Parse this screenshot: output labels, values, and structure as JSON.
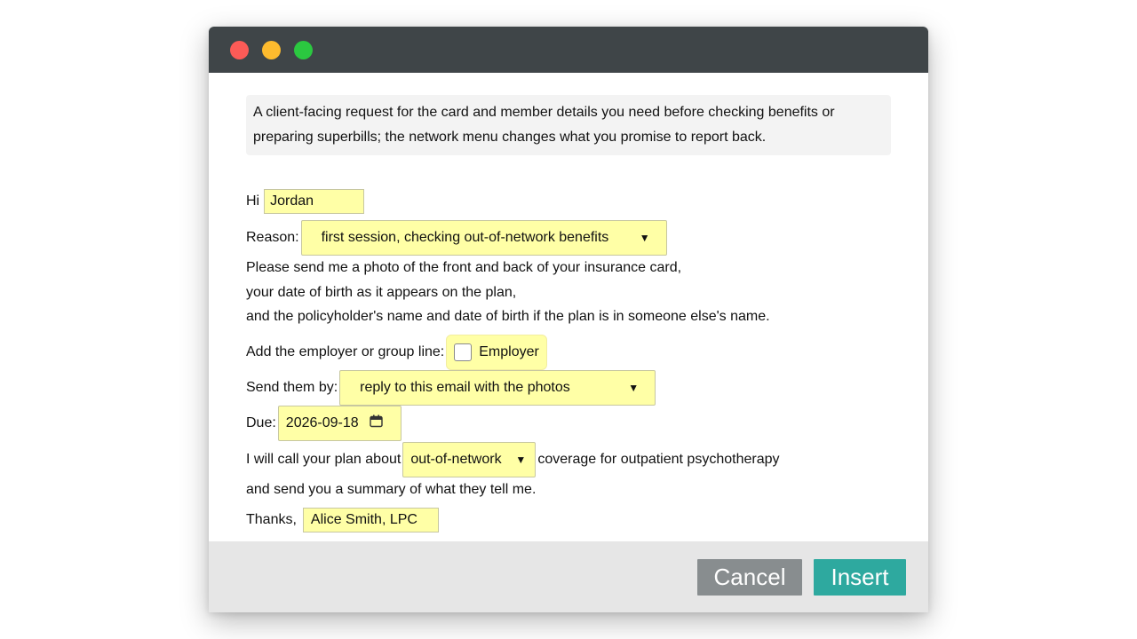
{
  "colors": {
    "titlebar": "#3f4548",
    "field_fill": "#ffffa6",
    "cancel_button": "#888d8f",
    "insert_button": "#2ea99f",
    "footer": "#e6e6e6"
  },
  "icons": [
    "close-light",
    "minimize-light",
    "zoom-light",
    "chevron-down-icon",
    "calendar-icon"
  ],
  "description": "A client-facing request for the card and member details you need before checking benefits or preparing superbills; the network menu changes what you promise to report back.",
  "greeting": {
    "label": "Hi",
    "name_value": "Jordan"
  },
  "reason": {
    "label": "Reason:",
    "selected": "first session, checking out-of-network benefits"
  },
  "body_lines": [
    "Please send me a photo of the front and back of your insurance card,",
    "your date of birth as it appears on the plan,",
    "and the policyholder's name and date of birth if the plan is in someone else's name."
  ],
  "employer": {
    "label": "Add the employer or group line:",
    "checkbox_label": "Employer",
    "checked": false
  },
  "send_by": {
    "label": "Send them by:",
    "selected": "reply to this email with the photos"
  },
  "due": {
    "label": "Due:",
    "value": "2026-09-18"
  },
  "network": {
    "prefix": "I will call your plan about",
    "selected": "out-of-network",
    "suffix": "coverage for outpatient psychotherapy"
  },
  "closing_line": "and send you a summary of what they tell me.",
  "signoff": {
    "label": "Thanks,",
    "signature_value": "Alice Smith, LPC"
  },
  "buttons": {
    "cancel": "Cancel",
    "insert": "Insert"
  }
}
